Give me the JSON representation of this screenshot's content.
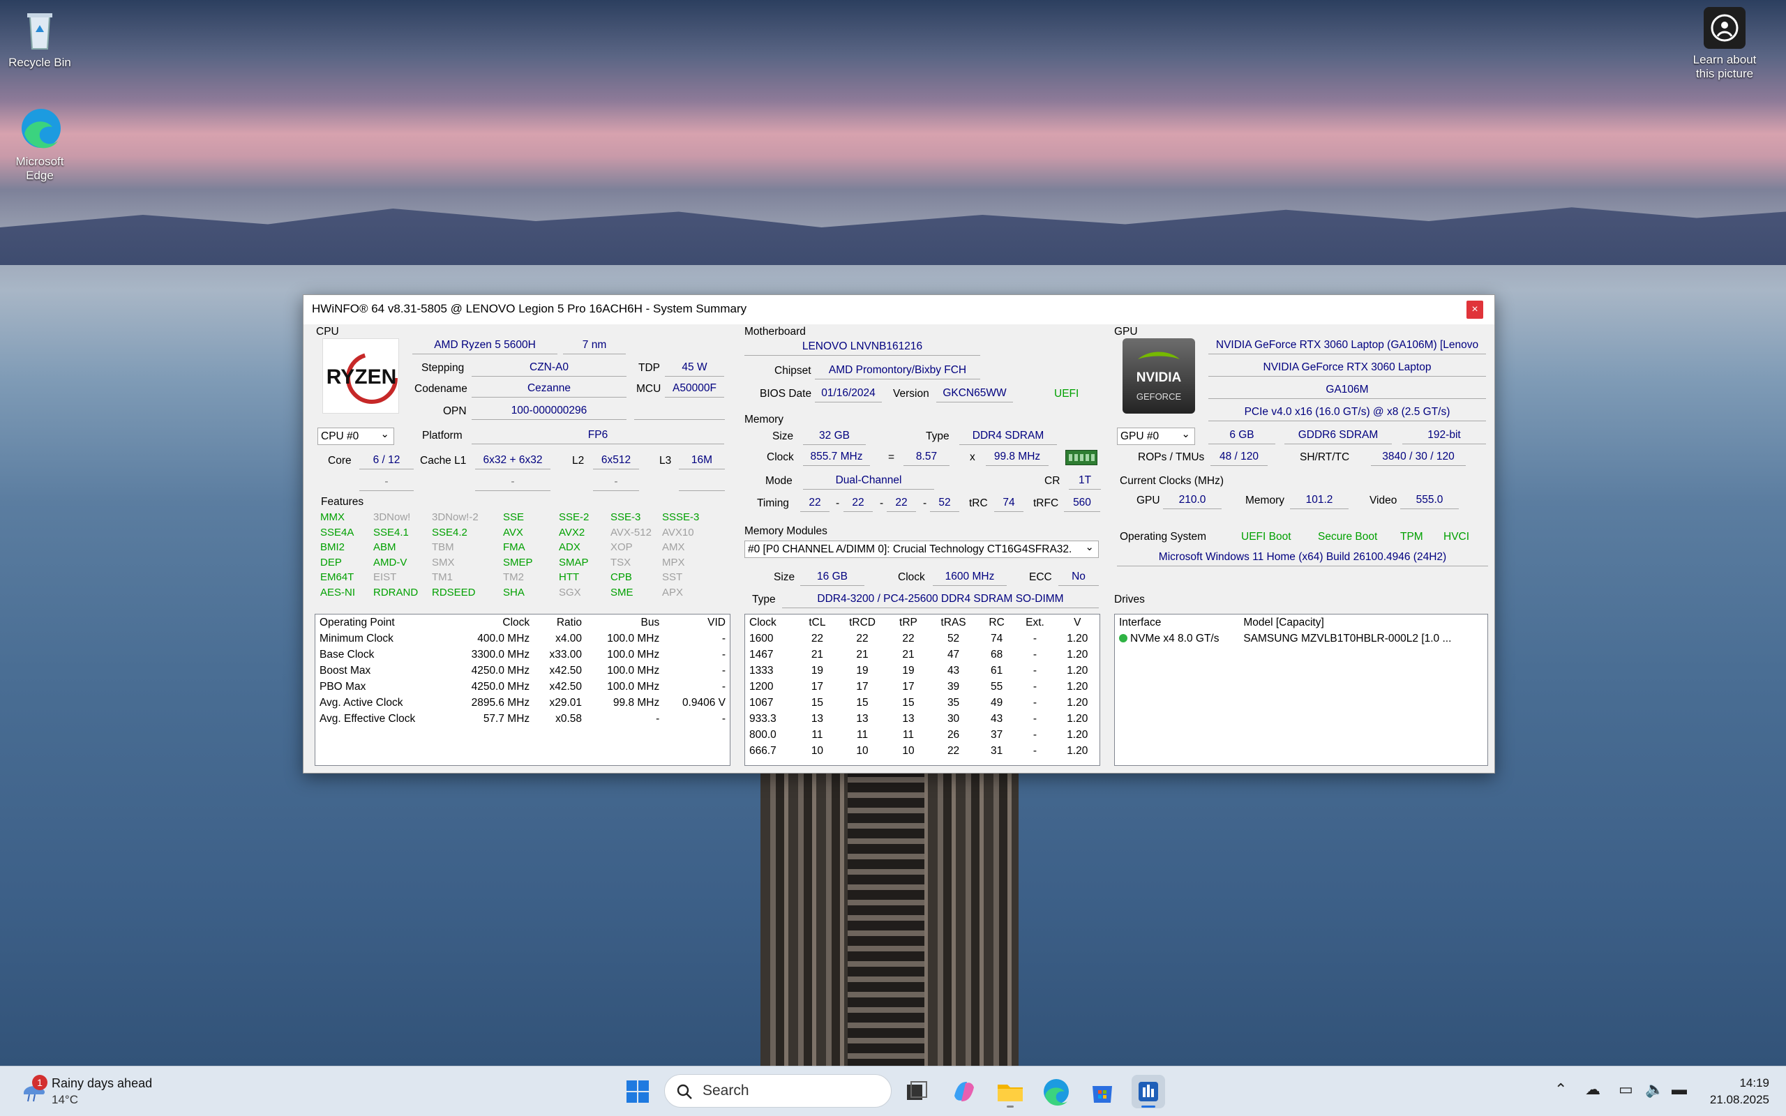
{
  "desktop": {
    "recycle_bin": "Recycle Bin",
    "edge_line1": "Microsoft",
    "edge_line2": "Edge",
    "learn_line1": "Learn about",
    "learn_line2": "this picture"
  },
  "window": {
    "title": "HWiNFO® 64 v8.31-5805 @ LENOVO Legion 5 Pro 16ACH6H - System Summary",
    "close": "×"
  },
  "cpu": {
    "section": "CPU",
    "logo": "RYZEN",
    "name": "AMD Ryzen 5 5600H",
    "process": "7 nm",
    "stepping_label": "Stepping",
    "stepping": "CZN-A0",
    "tdp_label": "TDP",
    "tdp": "45 W",
    "codename_label": "Codename",
    "codename": "Cezanne",
    "mcu_label": "MCU",
    "mcu": "A50000F",
    "opn_label": "OPN",
    "opn": "100-000000296",
    "selector": "CPU #0",
    "platform_label": "Platform",
    "platform": "FP6",
    "core_label": "Core",
    "core": "6 / 12",
    "l1_label": "Cache L1",
    "l1": "6x32 + 6x32",
    "l2_label": "L2",
    "l2": "6x512",
    "l3_label": "L3",
    "l3": "16M",
    "dash1": "-",
    "dash2": "-",
    "dash3": "-",
    "features_label": "Features",
    "features": [
      [
        [
          "MMX",
          true
        ],
        [
          "3DNow!",
          false
        ],
        [
          "3DNow!-2",
          false
        ],
        [
          "SSE",
          true
        ],
        [
          "SSE-2",
          true
        ],
        [
          "SSE-3",
          true
        ],
        [
          "SSSE-3",
          true
        ]
      ],
      [
        [
          "SSE4A",
          true
        ],
        [
          "SSE4.1",
          true
        ],
        [
          "SSE4.2",
          true
        ],
        [
          "AVX",
          true
        ],
        [
          "AVX2",
          true
        ],
        [
          "AVX-512",
          false
        ],
        [
          "AVX10",
          false
        ]
      ],
      [
        [
          "BMI2",
          true
        ],
        [
          "ABM",
          true
        ],
        [
          "TBM",
          false
        ],
        [
          "FMA",
          true
        ],
        [
          "ADX",
          true
        ],
        [
          "XOP",
          false
        ],
        [
          "AMX",
          false
        ]
      ],
      [
        [
          "DEP",
          true
        ],
        [
          "AMD-V",
          true
        ],
        [
          "SMX",
          false
        ],
        [
          "SMEP",
          true
        ],
        [
          "SMAP",
          true
        ],
        [
          "TSX",
          false
        ],
        [
          "MPX",
          false
        ]
      ],
      [
        [
          "EM64T",
          true
        ],
        [
          "EIST",
          false
        ],
        [
          "TM1",
          false
        ],
        [
          "TM2",
          false
        ],
        [
          "HTT",
          true
        ],
        [
          "CPB",
          true
        ],
        [
          "SST",
          false
        ]
      ],
      [
        [
          "AES-NI",
          true
        ],
        [
          "RDRAND",
          true
        ],
        [
          "RDSEED",
          true
        ],
        [
          "SHA",
          true
        ],
        [
          "SGX",
          false
        ],
        [
          "SME",
          true
        ],
        [
          "APX",
          false
        ]
      ]
    ],
    "op_headers": [
      "Operating Point",
      "Clock",
      "Ratio",
      "Bus",
      "VID"
    ],
    "op_rows": [
      [
        "Minimum Clock",
        "400.0 MHz",
        "x4.00",
        "100.0 MHz",
        "-"
      ],
      [
        "Base Clock",
        "3300.0 MHz",
        "x33.00",
        "100.0 MHz",
        "-"
      ],
      [
        "Boost Max",
        "4250.0 MHz",
        "x42.50",
        "100.0 MHz",
        "-"
      ],
      [
        "PBO Max",
        "4250.0 MHz",
        "x42.50",
        "100.0 MHz",
        "-"
      ],
      [
        "Avg. Active Clock",
        "2895.6 MHz",
        "x29.01",
        "99.8 MHz",
        "0.9406 V"
      ],
      [
        "Avg. Effective Clock",
        "57.7 MHz",
        "x0.58",
        "-",
        "-"
      ]
    ]
  },
  "mb": {
    "section": "Motherboard",
    "name": "LENOVO LNVNB161216",
    "chipset_label": "Chipset",
    "chipset": "AMD Promontory/Bixby FCH",
    "bios_label": "BIOS Date",
    "bios_date": "01/16/2024",
    "version_label": "Version",
    "version": "GKCN65WW",
    "uefi": "UEFI"
  },
  "mem": {
    "section": "Memory",
    "size_label": "Size",
    "size": "32 GB",
    "type_label": "Type",
    "type": "DDR4 SDRAM",
    "clock_label": "Clock",
    "clock": "855.7 MHz",
    "eq": "=",
    "mult": "8.57",
    "x": "x",
    "base": "99.8 MHz",
    "mode_label": "Mode",
    "mode": "Dual-Channel",
    "cr_label": "CR",
    "cr": "1T",
    "timing_label": "Timing",
    "t1": "22",
    "t2": "22",
    "t3": "22",
    "t4": "52",
    "trc_label": "tRC",
    "trc": "74",
    "trfc_label": "tRFC",
    "trfc": "560",
    "dash": "-"
  },
  "mods": {
    "section": "Memory Modules",
    "selector": "#0 [P0 CHANNEL A/DIMM 0]: Crucial Technology CT16G4SFRA32.",
    "size_label": "Size",
    "size": "16 GB",
    "clock_label": "Clock",
    "clock": "1600 MHz",
    "ecc_label": "ECC",
    "ecc": "No",
    "type_label": "Type",
    "type": "DDR4-3200 / PC4-25600 DDR4 SDRAM SO-DIMM",
    "headers": [
      "Clock",
      "tCL",
      "tRCD",
      "tRP",
      "tRAS",
      "RC",
      "Ext.",
      "V"
    ],
    "rows": [
      [
        "1600",
        "22",
        "22",
        "22",
        "52",
        "74",
        "-",
        "1.20"
      ],
      [
        "1467",
        "21",
        "21",
        "21",
        "47",
        "68",
        "-",
        "1.20"
      ],
      [
        "1333",
        "19",
        "19",
        "19",
        "43",
        "61",
        "-",
        "1.20"
      ],
      [
        "1200",
        "17",
        "17",
        "17",
        "39",
        "55",
        "-",
        "1.20"
      ],
      [
        "1067",
        "15",
        "15",
        "15",
        "35",
        "49",
        "-",
        "1.20"
      ],
      [
        "933.3",
        "13",
        "13",
        "13",
        "30",
        "43",
        "-",
        "1.20"
      ],
      [
        "800.0",
        "11",
        "11",
        "11",
        "26",
        "37",
        "-",
        "1.20"
      ],
      [
        "666.7",
        "10",
        "10",
        "10",
        "22",
        "31",
        "-",
        "1.20"
      ]
    ]
  },
  "gpu": {
    "section": "GPU",
    "logo_top": "NVIDIA",
    "logo_bottom": "GEFORCE",
    "name_full": "NVIDIA GeForce RTX 3060 Laptop (GA106M) [Lenovo",
    "name": "NVIDIA GeForce RTX 3060 Laptop",
    "chip": "GA106M",
    "pcie": "PCIe v4.0 x16 (16.0 GT/s) @ x8 (2.5 GT/s)",
    "selector": "GPU #0",
    "vram": "6 GB",
    "vram_type": "GDDR6 SDRAM",
    "bus": "192-bit",
    "rops_label": "ROPs / TMUs",
    "rops": "48 / 120",
    "sh_label": "SH/RT/TC",
    "sh": "3840 / 30 / 120",
    "clocks_label": "Current Clocks (MHz)",
    "gpu_clk_label": "GPU",
    "gpu_clk": "210.0",
    "mem_clk_label": "Memory",
    "mem_clk": "101.2",
    "video_clk_label": "Video",
    "video_clk": "555.0"
  },
  "os": {
    "section": "Operating System",
    "uefi": "UEFI Boot",
    "secure": "Secure Boot",
    "tpm": "TPM",
    "hvci": "HVCI",
    "name": "Microsoft Windows 11 Home (x64) Build 26100.4946 (24H2)"
  },
  "drives": {
    "section": "Drives",
    "headers": [
      "Interface",
      "Model [Capacity]"
    ],
    "rows": [
      [
        "NVMe x4 8.0 GT/s",
        "SAMSUNG MZVLB1T0HBLR-000L2 [1.0 ..."
      ]
    ]
  },
  "taskbar": {
    "weather_title": "Rainy days ahead",
    "weather_temp": "14°C",
    "badge": "1",
    "search": "Search",
    "time": "14:19",
    "date": "21.08.2025"
  }
}
